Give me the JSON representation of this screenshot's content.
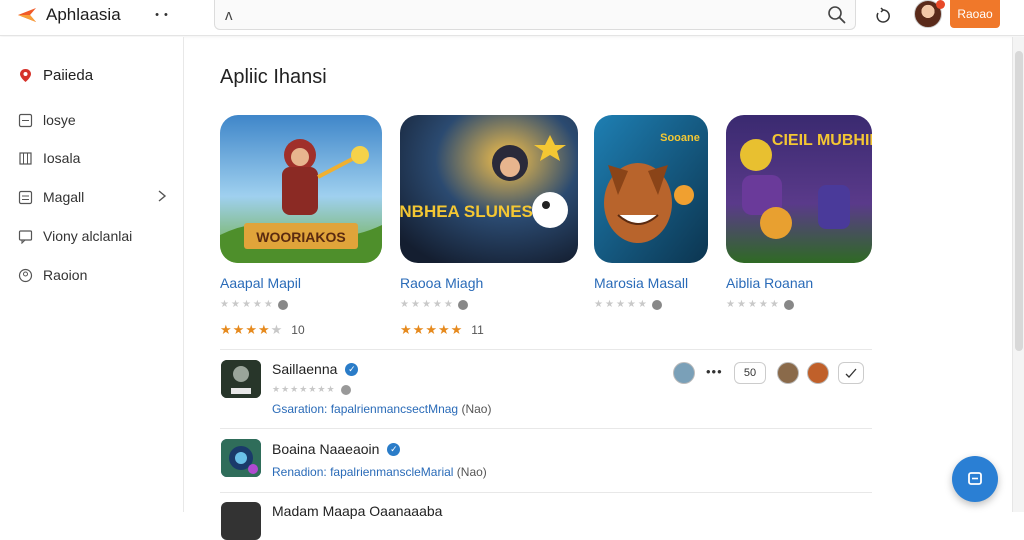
{
  "app": {
    "name": "Aphlaasia"
  },
  "header": {
    "dots_label": "• •",
    "search_value": "ʌ",
    "cta_label": "Raoao"
  },
  "sidebar": {
    "items": [
      {
        "label": "Paiieda",
        "icon": "location-pin-icon"
      },
      {
        "label": "losye",
        "icon": "square-icon"
      },
      {
        "label": "Iosala",
        "icon": "bookmark-icon"
      },
      {
        "label": "Magall",
        "icon": "grid-icon"
      },
      {
        "label": "Viony alclanlai",
        "icon": "chat-icon"
      },
      {
        "label": "Raoion",
        "icon": "user-circle-icon"
      }
    ]
  },
  "main": {
    "section_title": "Apliic Ihansi",
    "cards": [
      {
        "title": "Aaapal Mapil",
        "stars": 4,
        "count": "10",
        "art": "WOORIAKOS",
        "colors": [
          "#3f86c9",
          "#7cb342"
        ]
      },
      {
        "title": "Raooa Miagh",
        "stars": 5,
        "count": "11",
        "art": "UNBHEA SLUNES",
        "colors": [
          "#1d3553",
          "#e8a33a"
        ]
      },
      {
        "title": "Marosia Masall",
        "stars": 0,
        "count": "",
        "art": "Sooane",
        "colors": [
          "#1e7fb3",
          "#c97a3a"
        ]
      },
      {
        "title": "Aiblia Roanan",
        "stars": 0,
        "count": "",
        "art": "CIEIL MUBHIE",
        "colors": [
          "#36246a",
          "#3a7e2a"
        ]
      }
    ],
    "rows": [
      {
        "title": "Saillaenna",
        "label": "Gsaration:",
        "link": "fapalrienmancsectMnag",
        "paren": "(Nao)"
      },
      {
        "title": "Boaina Naaeaoin",
        "label": "Renadion:",
        "link": "fapalrienmanscleMarial",
        "paren": "(Nao)"
      },
      {
        "title": "Madam Maapa Oaanaaaba",
        "label": "",
        "link": "",
        "paren": ""
      }
    ],
    "row_pill": "50"
  },
  "colors": {
    "accent": "#f0782a",
    "link": "#2a6bb8",
    "fab": "#2a7fd4"
  }
}
